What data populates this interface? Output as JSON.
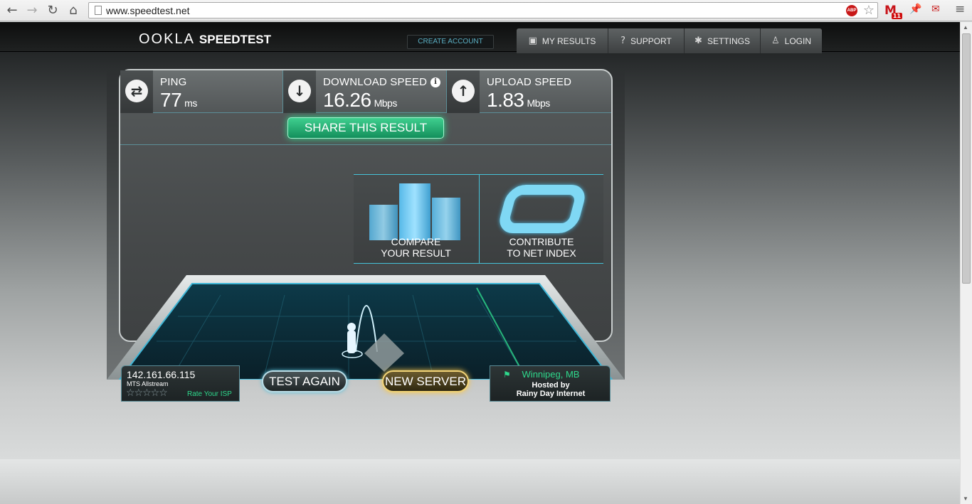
{
  "browser": {
    "back_icon": "←",
    "forward_icon": "→",
    "reload_icon": "↻",
    "home_icon": "⌂",
    "url": "www.speedtest.net",
    "adblock_label": "ABP",
    "star_icon": "☆",
    "gmail_letter": "M",
    "gmail_count": "11",
    "ext_pin_icon": "📌",
    "ext_pdf_icon": "✉",
    "menu_icon": "≡"
  },
  "header": {
    "logo_ookla": "OOKLA",
    "logo_speedtest": "SPEEDTEST",
    "create_account": "CREATE ACCOUNT",
    "nav": [
      {
        "label": "MY RESULTS",
        "icon": "▣"
      },
      {
        "label": "SUPPORT",
        "icon": "?"
      },
      {
        "label": "SETTINGS",
        "icon": "✱"
      },
      {
        "label": "LOGIN",
        "icon": "♙"
      }
    ]
  },
  "results": {
    "ping": {
      "label": "PING",
      "value": "77",
      "unit": "ms",
      "icon": "⇄"
    },
    "download": {
      "label": "DOWNLOAD SPEED",
      "value": "16.26",
      "unit": "Mbps",
      "icon": "↓",
      "info": "i"
    },
    "upload": {
      "label": "UPLOAD SPEED",
      "value": "1.83",
      "unit": "Mbps",
      "icon": "↑"
    },
    "share_button": "SHARE THIS RESULT"
  },
  "cards": {
    "compare_line1": "COMPARE",
    "compare_line2": "YOUR RESULT",
    "contribute_line1": "CONTRIBUTE",
    "contribute_line2": "TO NET INDEX"
  },
  "footer": {
    "ip": "142.161.66.115",
    "isp": "MTS Allstream",
    "stars": "☆☆☆☆☆",
    "rate_isp": "Rate Your ISP",
    "test_again": "TEST AGAIN",
    "new_server": "NEW SERVER",
    "server_city": "Winnipeg, MB",
    "hosted_by": "Hosted by",
    "host_name": "Rainy Day Internet"
  },
  "colors": {
    "accent_green": "#2ed88c",
    "accent_cyan": "#46c2d8",
    "accent_gold": "#f2d477"
  }
}
